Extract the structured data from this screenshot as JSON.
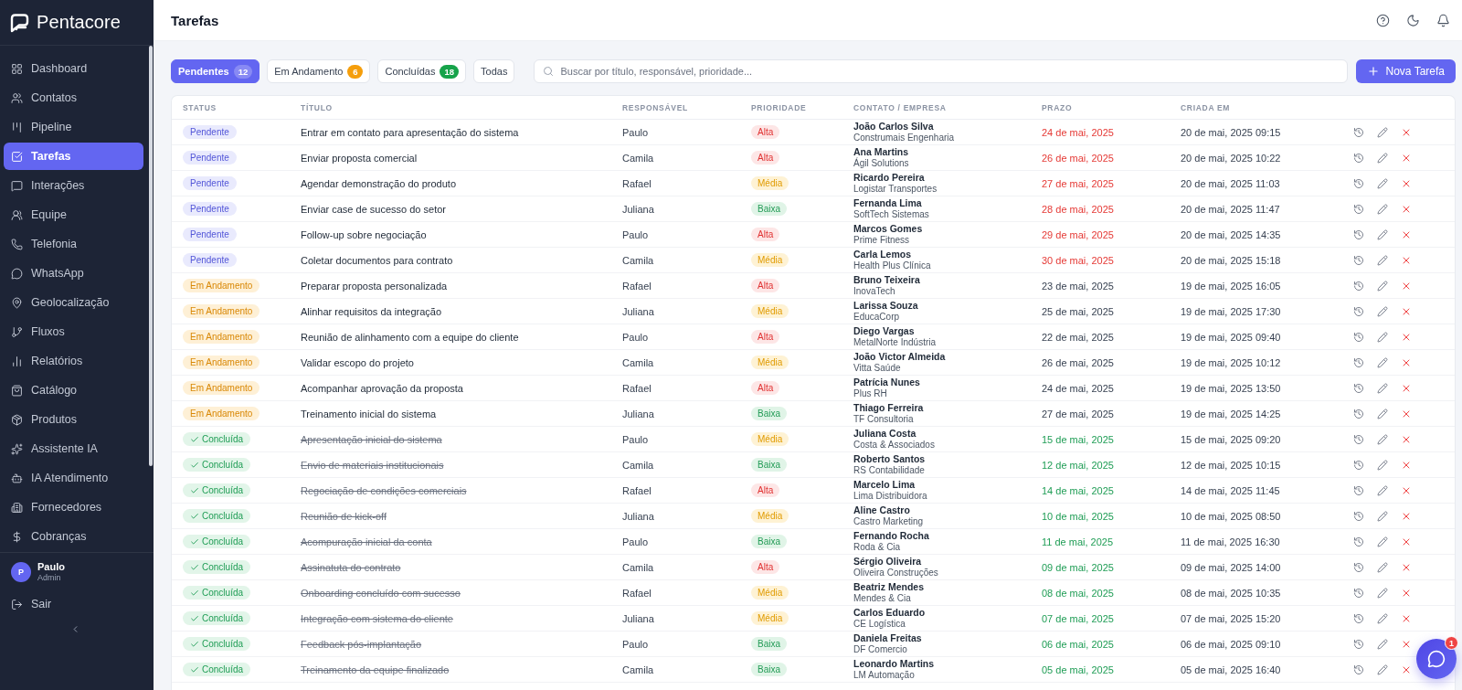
{
  "sidebar": {
    "brand": "Pentacore",
    "items": [
      {
        "label": "Dashboard",
        "selected": false
      },
      {
        "label": "Contatos",
        "selected": false
      },
      {
        "label": "Pipeline",
        "selected": false
      },
      {
        "label": "Tarefas",
        "selected": true
      },
      {
        "label": "Interações",
        "selected": false
      },
      {
        "label": "Equipe",
        "selected": false
      },
      {
        "label": "Telefonia",
        "selected": false
      },
      {
        "label": "WhatsApp",
        "selected": false
      },
      {
        "label": "Geolocalização",
        "selected": false
      },
      {
        "label": "Fluxos",
        "selected": false
      },
      {
        "label": "Relatórios",
        "selected": false
      },
      {
        "label": "Catálogo",
        "selected": false
      },
      {
        "label": "Produtos",
        "selected": false
      },
      {
        "label": "Assistente IA",
        "selected": false
      },
      {
        "label": "IA Atendimento",
        "selected": false
      },
      {
        "label": "Fornecedores",
        "selected": false
      },
      {
        "label": "Cobranças",
        "selected": false
      }
    ],
    "user": {
      "initial": "P",
      "name": "Paulo",
      "role": "Admin"
    },
    "logout": "Sair"
  },
  "header": {
    "title": "Tarefas"
  },
  "tabs": [
    {
      "label": "Pendentes",
      "count": "12",
      "kind": "pending",
      "selected": true
    },
    {
      "label": "Em Andamento",
      "count": "6",
      "kind": "progress",
      "selected": false
    },
    {
      "label": "Concluídas",
      "count": "18",
      "kind": "done",
      "selected": false
    },
    {
      "label": "Todas",
      "selected": false
    }
  ],
  "search": {
    "placeholder": "Buscar por título, responsável, prioridade..."
  },
  "new_button": {
    "label": "Nova Tarefa"
  },
  "table": {
    "columns": [
      "STATUS",
      "TÍTULO",
      "RESPONSÁVEL",
      "PRIORIDADE",
      "CONTATO / EMPRESA",
      "PRAZO",
      "CRIADA EM"
    ],
    "rows": [
      {
        "status": {
          "label": "Pendente",
          "kind": "pending"
        },
        "title": "Entrar em contato para apresentação do sistema",
        "assignee": "Paulo",
        "priority": {
          "label": "Alta",
          "kind": "high"
        },
        "contact": "João Carlos Silva",
        "company": "Construmais Engenharia",
        "due": "24 de mai, 2025",
        "created": "20 de mai, 2025 09:15"
      },
      {
        "status": {
          "label": "Pendente",
          "kind": "pending"
        },
        "title": "Enviar proposta comercial",
        "assignee": "Camila",
        "priority": {
          "label": "Alta",
          "kind": "high"
        },
        "contact": "Ana Martins",
        "company": "Ágil Solutions",
        "due": "26 de mai, 2025",
        "created": "20 de mai, 2025 10:22"
      },
      {
        "status": {
          "label": "Pendente",
          "kind": "pending"
        },
        "title": "Agendar demonstração do produto",
        "assignee": "Rafael",
        "priority": {
          "label": "Média",
          "kind": "medium"
        },
        "contact": "Ricardo Pereira",
        "company": "Logistar Transportes",
        "due": "27 de mai, 2025",
        "created": "20 de mai, 2025 11:03"
      },
      {
        "status": {
          "label": "Pendente",
          "kind": "pending"
        },
        "title": "Enviar case de sucesso do setor",
        "assignee": "Juliana",
        "priority": {
          "label": "Baixa",
          "kind": "low"
        },
        "contact": "Fernanda Lima",
        "company": "SoftTech Sistemas",
        "due": "28 de mai, 2025",
        "created": "20 de mai, 2025 11:47"
      },
      {
        "status": {
          "label": "Pendente",
          "kind": "pending"
        },
        "title": "Follow-up sobre negociação",
        "assignee": "Paulo",
        "priority": {
          "label": "Alta",
          "kind": "high"
        },
        "contact": "Marcos Gomes",
        "company": "Prime Fitness",
        "due": "29 de mai, 2025",
        "created": "20 de mai, 2025 14:35"
      },
      {
        "status": {
          "label": "Pendente",
          "kind": "pending"
        },
        "title": "Coletar documentos para contrato",
        "assignee": "Camila",
        "priority": {
          "label": "Média",
          "kind": "medium"
        },
        "contact": "Carla Lemos",
        "company": "Health Plus Clínica",
        "due": "30 de mai, 2025",
        "created": "20 de mai, 2025 15:18"
      },
      {
        "status": {
          "label": "Em Andamento",
          "kind": "progress"
        },
        "title": "Preparar proposta personalizada",
        "assignee": "Rafael",
        "priority": {
          "label": "Alta",
          "kind": "high"
        },
        "contact": "Bruno Teixeira",
        "company": "InovaTech",
        "due": "23 de mai, 2025",
        "created": "19 de mai, 2025 16:05"
      },
      {
        "status": {
          "label": "Em Andamento",
          "kind": "progress"
        },
        "title": "Alinhar requisitos da integração",
        "assignee": "Juliana",
        "priority": {
          "label": "Média",
          "kind": "medium"
        },
        "contact": "Larissa Souza",
        "company": "EducaCorp",
        "due": "25 de mai, 2025",
        "created": "19 de mai, 2025 17:30"
      },
      {
        "status": {
          "label": "Em Andamento",
          "kind": "progress"
        },
        "title": "Reunião de alinhamento com a equipe do cliente",
        "assignee": "Paulo",
        "priority": {
          "label": "Alta",
          "kind": "high"
        },
        "contact": "Diego Vargas",
        "company": "MetalNorte Indústria",
        "due": "22 de mai, 2025",
        "created": "19 de mai, 2025 09:40"
      },
      {
        "status": {
          "label": "Em Andamento",
          "kind": "progress"
        },
        "title": "Validar escopo do projeto",
        "assignee": "Camila",
        "priority": {
          "label": "Média",
          "kind": "medium"
        },
        "contact": "João Victor Almeida",
        "company": "Vitta Saúde",
        "due": "26 de mai, 2025",
        "created": "19 de mai, 2025 10:12"
      },
      {
        "status": {
          "label": "Em Andamento",
          "kind": "progress"
        },
        "title": "Acompanhar aprovação da proposta",
        "assignee": "Rafael",
        "priority": {
          "label": "Alta",
          "kind": "high"
        },
        "contact": "Patrícia Nunes",
        "company": "Plus RH",
        "due": "24 de mai, 2025",
        "created": "19 de mai, 2025 13:50"
      },
      {
        "status": {
          "label": "Em Andamento",
          "kind": "progress"
        },
        "title": "Treinamento inicial do sistema",
        "assignee": "Juliana",
        "priority": {
          "label": "Baixa",
          "kind": "low"
        },
        "contact": "Thiago Ferreira",
        "company": "TF Consultoria",
        "due": "27 de mai, 2025",
        "created": "19 de mai, 2025 14:25"
      },
      {
        "status": {
          "label": "Concluída",
          "kind": "done"
        },
        "title": "Apresentação inicial do sistema",
        "assignee": "Paulo",
        "priority": {
          "label": "Média",
          "kind": "medium"
        },
        "contact": "Juliana Costa",
        "company": "Costa & Associados",
        "due": "15 de mai, 2025",
        "created": "15 de mai, 2025 09:20"
      },
      {
        "status": {
          "label": "Concluída",
          "kind": "done"
        },
        "title": "Envio de materiais institucionais",
        "assignee": "Camila",
        "priority": {
          "label": "Baixa",
          "kind": "low"
        },
        "contact": "Roberto Santos",
        "company": "RS Contabilidade",
        "due": "12 de mai, 2025",
        "created": "12 de mai, 2025 10:15"
      },
      {
        "status": {
          "label": "Concluída",
          "kind": "done"
        },
        "title": "Regociação de condições comerciais",
        "assignee": "Rafael",
        "priority": {
          "label": "Alta",
          "kind": "high"
        },
        "contact": "Marcelo Lima",
        "company": "Lima Distribuidora",
        "due": "14 de mai, 2025",
        "created": "14 de mai, 2025 11:45"
      },
      {
        "status": {
          "label": "Concluída",
          "kind": "done"
        },
        "title": "Reunião de kick-off",
        "assignee": "Juliana",
        "priority": {
          "label": "Média",
          "kind": "medium"
        },
        "contact": "Aline Castro",
        "company": "Castro Marketing",
        "due": "10 de mai, 2025",
        "created": "10 de mai, 2025 08:50"
      },
      {
        "status": {
          "label": "Concluída",
          "kind": "done"
        },
        "title": "Acompuração inicial da conta",
        "assignee": "Paulo",
        "priority": {
          "label": "Baixa",
          "kind": "low"
        },
        "contact": "Fernando Rocha",
        "company": "Roda & Cia",
        "due": "11 de mai, 2025",
        "created": "11 de mai, 2025 16:30"
      },
      {
        "status": {
          "label": "Concluída",
          "kind": "done"
        },
        "title": "Assinatuta do contrato",
        "assignee": "Camila",
        "priority": {
          "label": "Alta",
          "kind": "high"
        },
        "contact": "Sérgio Oliveira",
        "company": "Oliveira Construções",
        "due": "09 de mai, 2025",
        "created": "09 de mai, 2025 14:00"
      },
      {
        "status": {
          "label": "Concluída",
          "kind": "done"
        },
        "title": "Onboarding concluído com sucesso",
        "assignee": "Rafael",
        "priority": {
          "label": "Média",
          "kind": "medium"
        },
        "contact": "Beatriz Mendes",
        "company": "Mendes & Cia",
        "due": "08 de mai, 2025",
        "created": "08 de mai, 2025 10:35"
      },
      {
        "status": {
          "label": "Concluída",
          "kind": "done"
        },
        "title": "Integração com sistema do cliente",
        "assignee": "Juliana",
        "priority": {
          "label": "Média",
          "kind": "medium"
        },
        "contact": "Carlos Eduardo",
        "company": "CE Logística",
        "due": "07 de mai, 2025",
        "created": "07 de mai, 2025 15:20"
      },
      {
        "status": {
          "label": "Concluída",
          "kind": "done"
        },
        "title": "Feedback pós-implantação",
        "assignee": "Paulo",
        "priority": {
          "label": "Baixa",
          "kind": "low"
        },
        "contact": "Daniela Freitas",
        "company": "DF Comercio",
        "due": "06 de mai, 2025",
        "created": "06 de mai, 2025 09:10"
      },
      {
        "status": {
          "label": "Concluída",
          "kind": "done"
        },
        "title": "Treinamento da equipe finalizado",
        "assignee": "Camila",
        "priority": {
          "label": "Baixa",
          "kind": "low"
        },
        "contact": "Leonardo Martins",
        "company": "LM Automação",
        "due": "05 de mai, 2025",
        "created": "05 de mai, 2025 16:40"
      }
    ]
  },
  "chat_button": {
    "badge": "1"
  }
}
